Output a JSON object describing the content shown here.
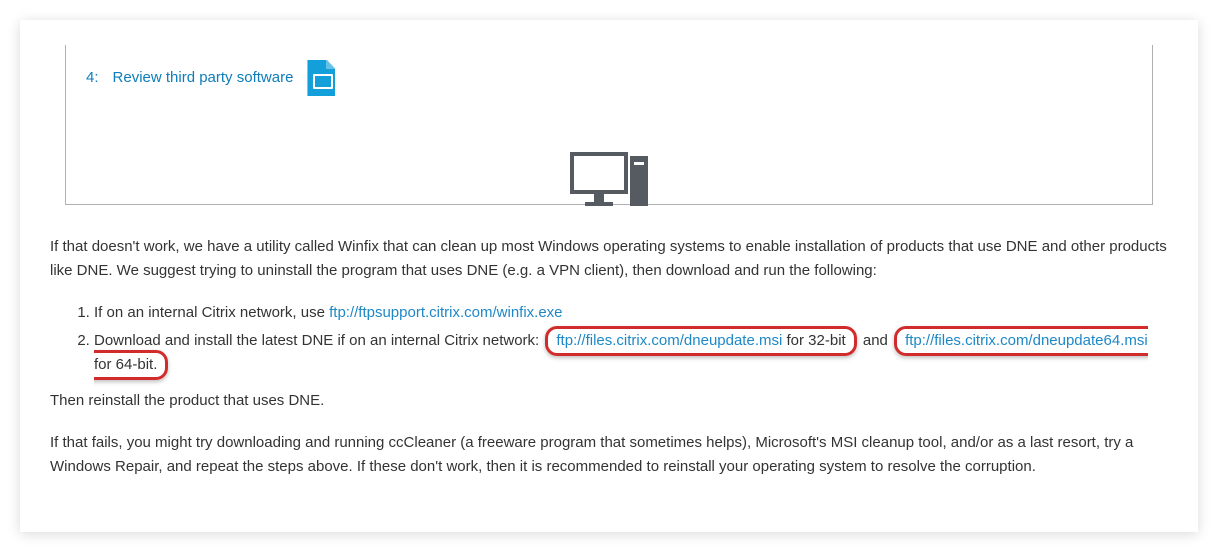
{
  "step": {
    "number": "4:",
    "label": "Review third party software"
  },
  "para1": "If that doesn't work, we have a utility called Winfix that can clean up most Windows operating systems to enable installation of products that use DNE and other products like DNE. We suggest trying to uninstall the program that uses DNE (e.g. a VPN client), then download and run the following:",
  "list": {
    "item1_pre": "If on an internal Citrix network, use ",
    "item1_link": "ftp://ftpsupport.citrix.com/winfix.exe",
    "item2_pre": "Download and install the latest DNE if on an internal Citrix network: ",
    "item2_link32": "ftp://files.citrix.com/dneupdate.msi",
    "item2_mid": " for 32-bit",
    "item2_and": " and ",
    "item2_link64": "ftp://files.citrix.com/dneupdate64.msi",
    "item2_end": " for 64-bit."
  },
  "para2": "Then reinstall the product that uses DNE.",
  "para3": "If that fails, you might try downloading and running ccCleaner (a freeware program that sometimes helps), Microsoft's MSI cleanup tool, and/or as a last resort, try a Windows Repair, and repeat the steps above. If these don't work, then it is recommended to reinstall your operating system to resolve the corruption."
}
